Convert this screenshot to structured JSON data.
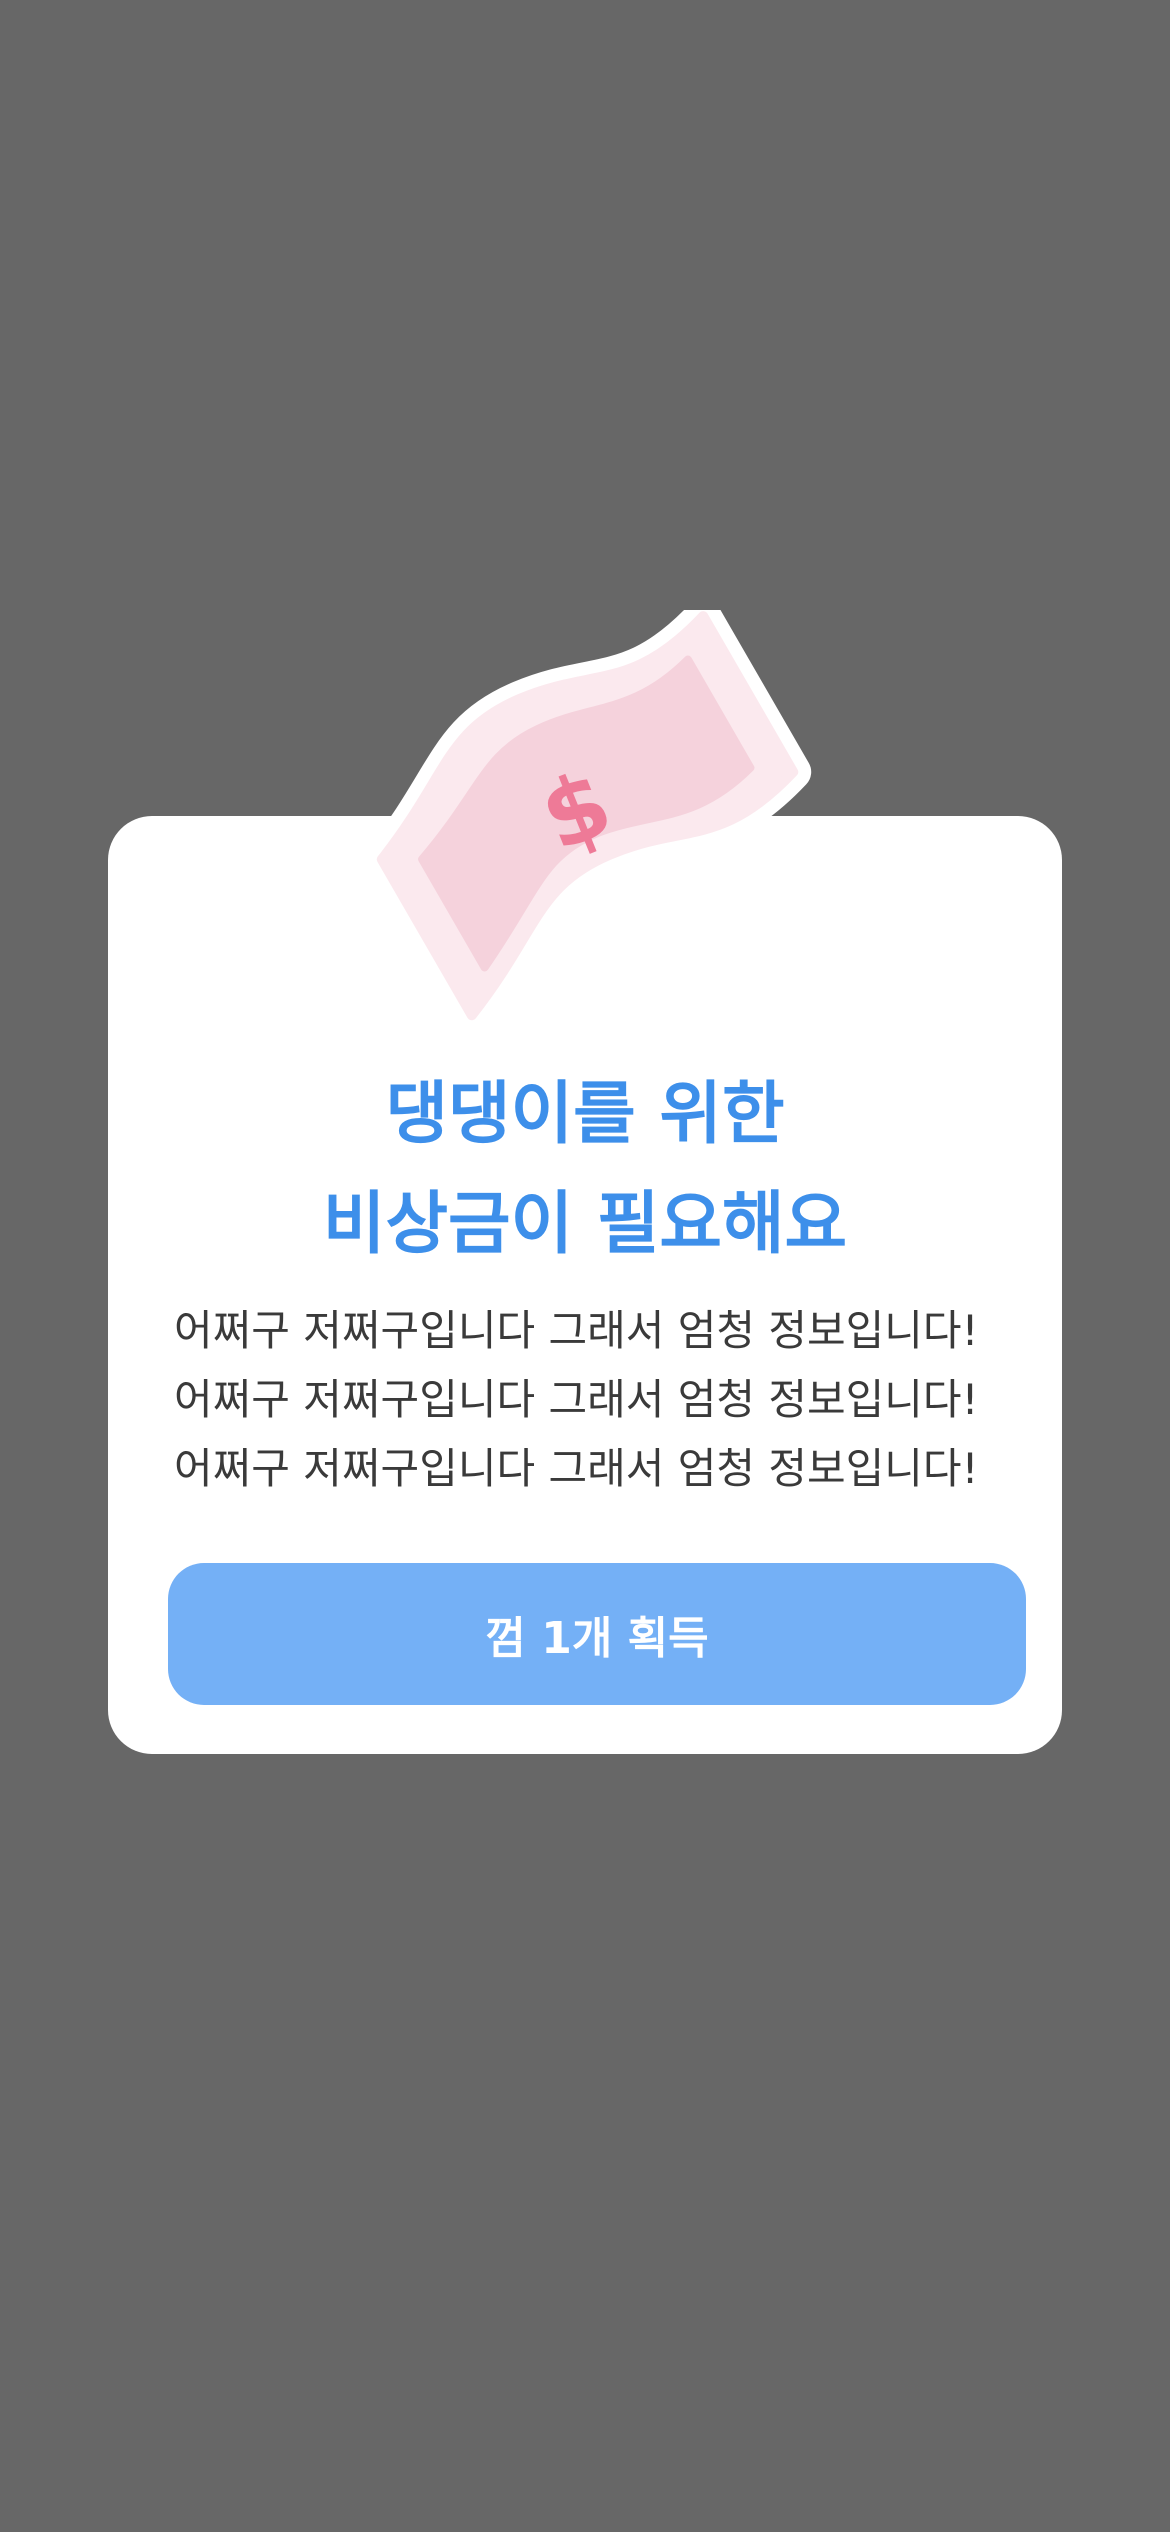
{
  "modal": {
    "illustration_icon": "money-bill-icon",
    "illustration_symbol": "$",
    "title_lines": [
      "댕댕이를 위한",
      "비상금이 필요해요"
    ],
    "body_lines": [
      "어쩌구 저쩌구입니다 그래서 엄청 정보입니다!",
      "어쩌구 저쩌구입니다 그래서 엄청 정보입니다!",
      "어쩌구 저쩌구입니다 그래서 엄청 정보입니다!"
    ],
    "cta_label": "껌 1개 획득"
  },
  "colors": {
    "overlay": "#676767",
    "card": "#FFFFFF",
    "title": "#3D8FEA",
    "body": "#3A3A3A",
    "button": "#74B0F6",
    "button_text": "#FFFFFF",
    "bill_pink": "#F5D2DC",
    "dollar_pink": "#EE7A97"
  }
}
